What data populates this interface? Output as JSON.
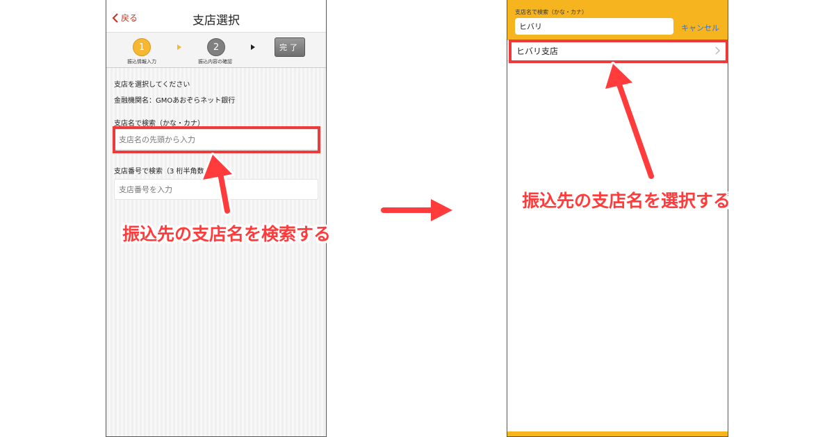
{
  "left_screen": {
    "nav": {
      "back_label": "戻る",
      "title": "支店選択"
    },
    "steps": {
      "step1_number": "1",
      "step1_label": "振込情報入力",
      "step2_number": "2",
      "step2_label": "振込内容の確認",
      "done_label": "完了"
    },
    "content": {
      "prompt": "支店を選択してください",
      "bank_name": "金融機関名：GMOあおぞらネット銀行",
      "name_search_label": "支店名で検索（かな・カナ）",
      "name_search_placeholder": "支店名の先頭から入力",
      "number_search_label": "支店番号で検索（3 桁半角数",
      "number_search_placeholder": "支店番号を入力"
    }
  },
  "right_screen": {
    "search": {
      "label": "支店名で検索（かな・カナ）",
      "value": "ヒバリ",
      "cancel_label": "キャンセル"
    },
    "results": [
      {
        "label": "ヒバリ支店"
      }
    ]
  },
  "annotations": {
    "left_text": "振込先の支店名を検索する",
    "right_text": "振込先の支店名を選択する"
  },
  "colors": {
    "accent_red": "#ee3a3a",
    "header_yellow": "#f6b51e",
    "step_active": "#f6b732",
    "link_blue": "#2f6fdc"
  }
}
